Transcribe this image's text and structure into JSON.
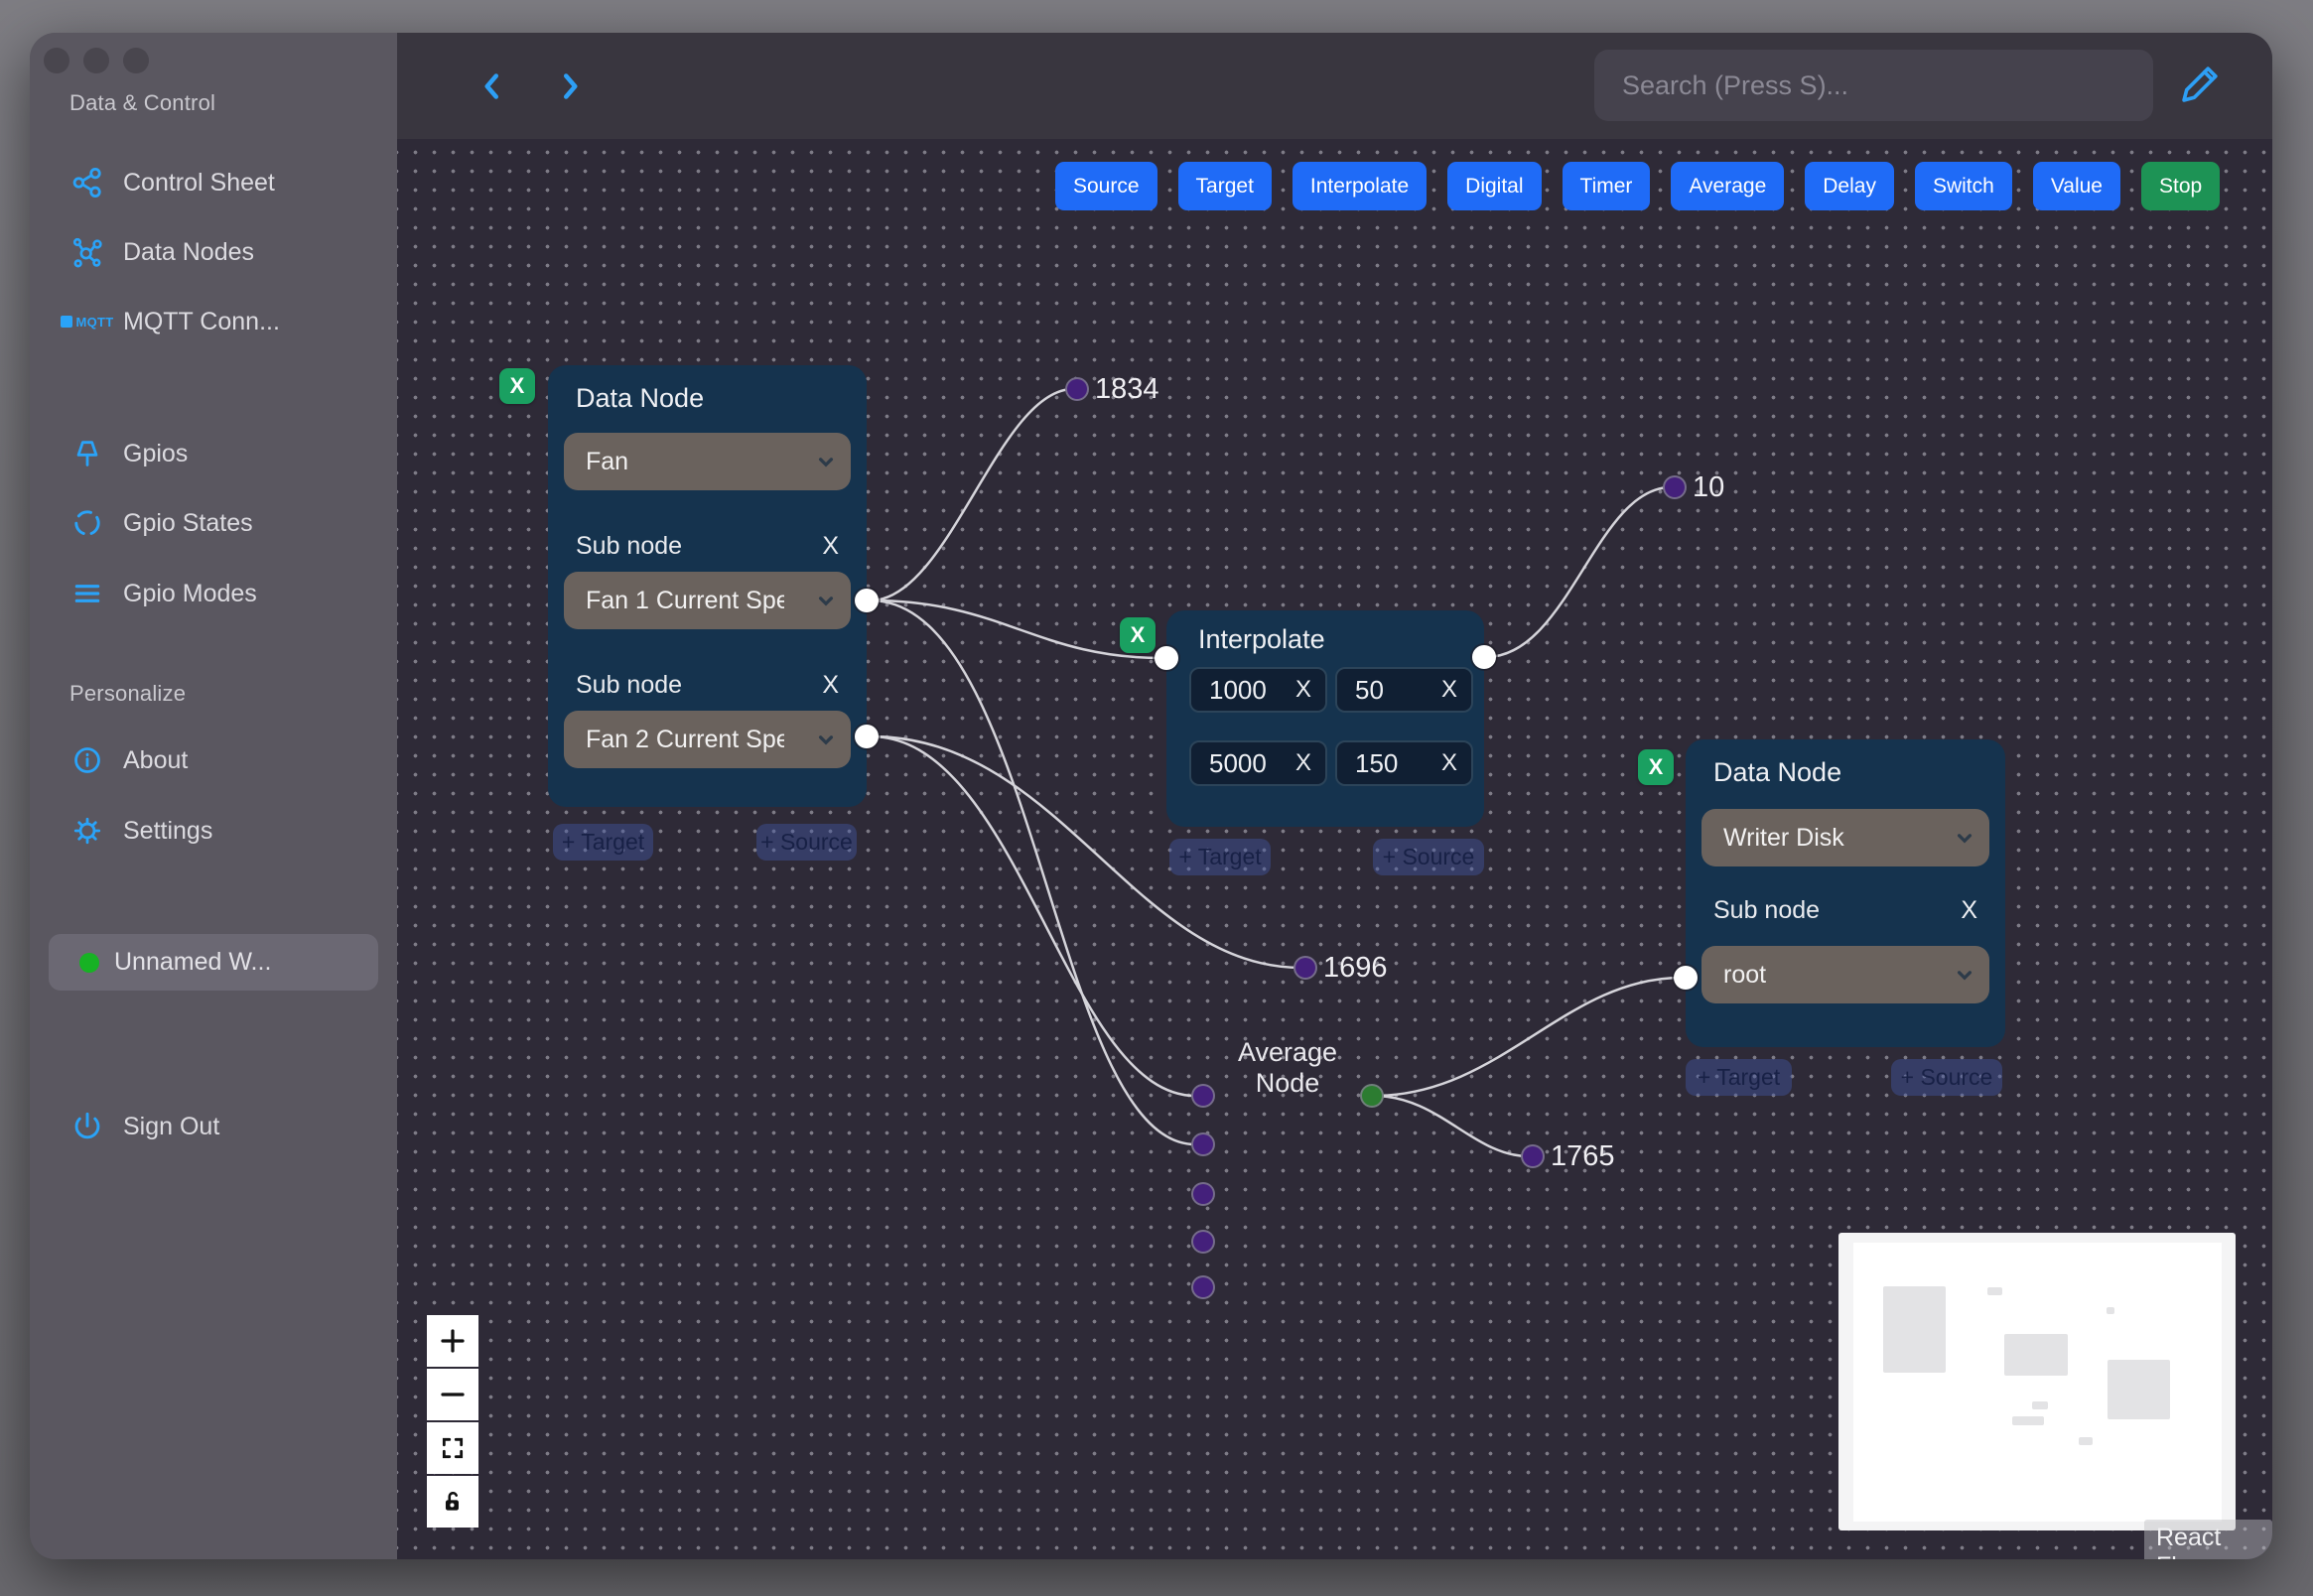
{
  "sidebar": {
    "header_data_control": "Data & Control",
    "items": [
      {
        "label": "Control Sheet",
        "icon": "control-sheet-icon"
      },
      {
        "label": "Data Nodes",
        "icon": "data-nodes-icon"
      },
      {
        "label": "MQTT Conn...",
        "icon": "mqtt-icon",
        "icon_text": "MQTT"
      },
      {
        "label": "Gpios",
        "icon": "pin-icon"
      },
      {
        "label": "Gpio States",
        "icon": "dashed-circle-icon"
      },
      {
        "label": "Gpio Modes",
        "icon": "lines-icon"
      }
    ],
    "header_personalize": "Personalize",
    "personalize_items": [
      {
        "label": "About",
        "icon": "info-icon"
      },
      {
        "label": "Settings",
        "icon": "gear-icon"
      }
    ],
    "workspace": {
      "label": "Unnamed W...",
      "status_color": "#17b224"
    },
    "sign_out_label": "Sign Out"
  },
  "topbar": {
    "search_placeholder": "Search (Press S)..."
  },
  "toolbar": {
    "buttons": [
      {
        "label": "Source",
        "color": "#1f6bf7"
      },
      {
        "label": "Target",
        "color": "#1f6bf7"
      },
      {
        "label": "Interpolate",
        "color": "#1f6bf7"
      },
      {
        "label": "Digital",
        "color": "#1f6bf7"
      },
      {
        "label": "Timer",
        "color": "#1f6bf7"
      },
      {
        "label": "Average",
        "color": "#1f6bf7"
      },
      {
        "label": "Delay",
        "color": "#1f6bf7"
      },
      {
        "label": "Switch",
        "color": "#1f6bf7"
      },
      {
        "label": "Value",
        "color": "#1f6bf7"
      },
      {
        "label": "Stop",
        "color": "#1d9355"
      }
    ]
  },
  "nodes": {
    "fan": {
      "title": "Data Node",
      "remove_label": "X",
      "device": "Fan",
      "sub1_label": "Sub node",
      "sub1_remove": "X",
      "sub1_value": "Fan 1 Current Spe",
      "sub2_label": "Sub node",
      "sub2_remove": "X",
      "sub2_value": "Fan 2 Current Spe",
      "add_target": "+ Target",
      "add_source": "+ Source"
    },
    "interpolate": {
      "title": "Interpolate",
      "remove_label": "X",
      "inputs": [
        {
          "value": "1000",
          "remove": "X"
        },
        {
          "value": "50",
          "remove": "X"
        },
        {
          "value": "5000",
          "remove": "X"
        },
        {
          "value": "150",
          "remove": "X"
        }
      ],
      "add_target": "+ Target",
      "add_source": "+ Source"
    },
    "writer": {
      "title": "Data Node",
      "remove_label": "X",
      "device": "Writer Disk",
      "sub_label": "Sub node",
      "sub_remove": "X",
      "sub_value": "root",
      "add_target": "+ Target",
      "add_source": "+ Source"
    },
    "average": {
      "title": "Average Node"
    }
  },
  "edge_labels": {
    "fan1_value": "1834",
    "interp_out": "10",
    "fan2_value": "1696",
    "avg_out": "1765"
  },
  "colors": {
    "accent_blue": "#1f6bf7",
    "stop_green": "#1d9355",
    "badge_green": "#1aa061",
    "handle_purple": "#44207b",
    "handle_green": "#2c7c31",
    "icon_blue": "#2aa3f8",
    "node_navy": "#15334e",
    "dropdown_gray": "#6a625d"
  },
  "controls": {
    "icons": [
      "plus-icon",
      "minus-icon",
      "fit-view-icon",
      "lock-icon"
    ]
  },
  "attribution": "React Flow"
}
